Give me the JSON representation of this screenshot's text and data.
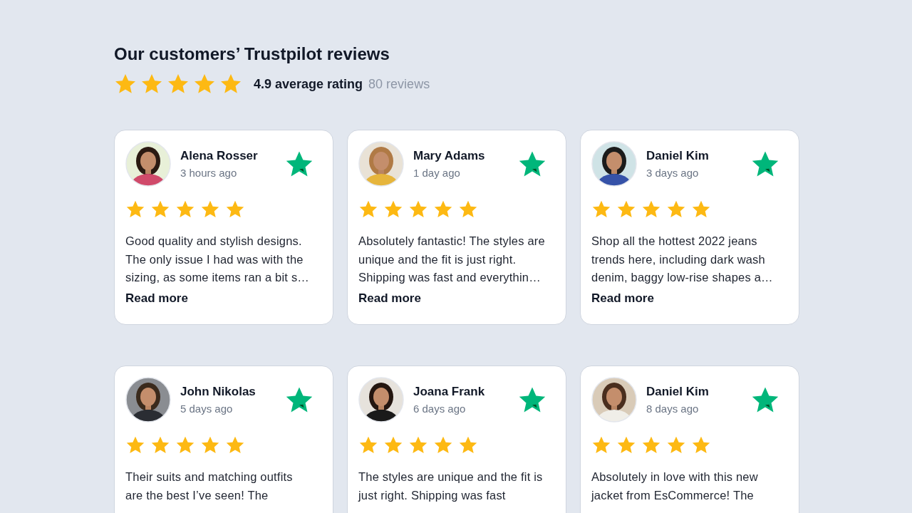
{
  "heading": "Our customers’ Trustpilot reviews",
  "summary": {
    "stars": 5,
    "rating": "4.9 average rating",
    "count": "80 reviews"
  },
  "reviews": [
    {
      "name": "Alena Rosser",
      "time": "3 hours ago",
      "stars": 5,
      "text": "Good quality and stylish designs. The only issue I had was with the sizing, as some items ran a bit s…",
      "link": "Read more"
    },
    {
      "name": "Mary Adams",
      "time": "1 day ago",
      "stars": 5,
      "text": "Absolutely fantastic! The styles are unique and the fit is just right. Shipping was fast and everythin…",
      "link": "Read more"
    },
    {
      "name": "Daniel Kim",
      "time": "3 days ago",
      "stars": 5,
      "text": "Shop all the hottest 2022 jeans trends here, including dark wash denim, baggy low-rise shapes a…",
      "link": "Read more"
    },
    {
      "name": "John Nikolas",
      "time": "5 days ago",
      "stars": 5,
      "text": "Their suits and matching outfits are the best I’ve seen! The"
    },
    {
      "name": "Joana Frank",
      "time": "6 days ago",
      "stars": 5,
      "text": " The styles are unique and the fit is just right. Shipping was fast"
    },
    {
      "name": "Daniel Kim",
      "time": "8 days ago",
      "stars": 5,
      "text": "Absolutely in love with this new jacket from EsCommerce! The"
    }
  ]
}
